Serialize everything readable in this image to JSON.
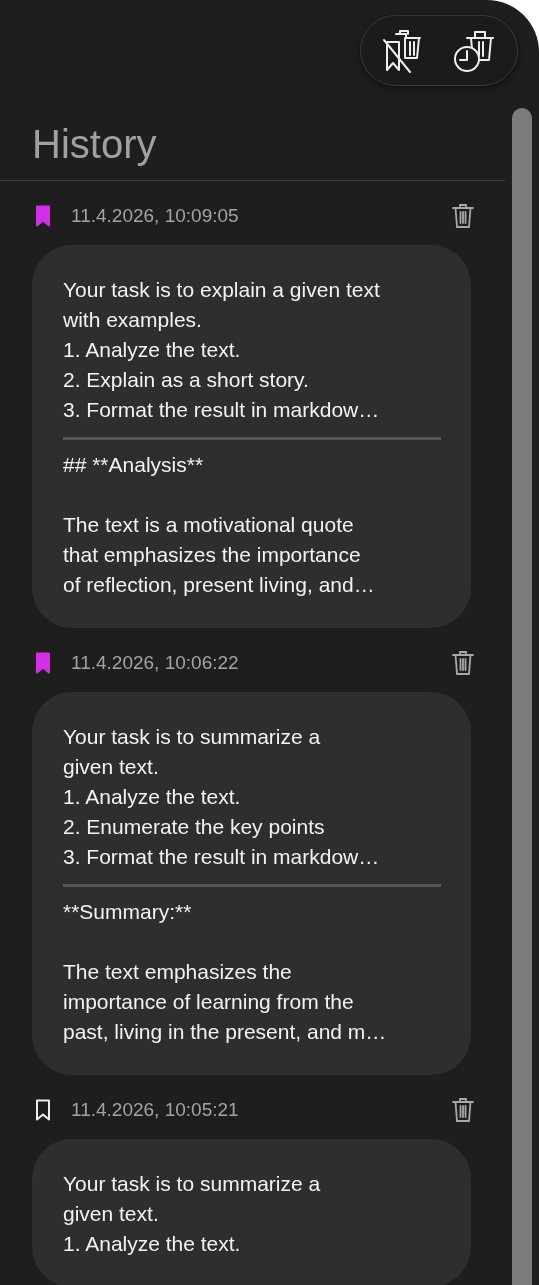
{
  "title": "History",
  "entries": [
    {
      "bookmarked": true,
      "timestamp": "11.4.2026, 10:09:05",
      "prompt": [
        "Your task is to explain a given text",
        "with examples.",
        "1. Analyze the text.",
        "2. Explain as a short story.",
        "3. Format the result in markdow…"
      ],
      "response": [
        [
          "## **Analysis**"
        ],
        [
          "The text is a motivational quote",
          "that emphasizes the importance",
          "of reflection, present living, and…"
        ]
      ]
    },
    {
      "bookmarked": true,
      "timestamp": "11.4.2026, 10:06:22",
      "prompt": [
        "Your task is to summarize a",
        "given text.",
        "1. Analyze the text.",
        "2. Enumerate the key points",
        "3. Format the result in markdow…"
      ],
      "response": [
        [
          "**Summary:**"
        ],
        [
          "The text emphasizes the",
          "importance of learning from the",
          "past, living in the present, and m…"
        ]
      ]
    },
    {
      "bookmarked": false,
      "timestamp": "11.4.2026, 10:05:21",
      "prompt": [
        "Your task is to summarize a",
        "given text.",
        "1. Analyze the text."
      ]
    }
  ]
}
